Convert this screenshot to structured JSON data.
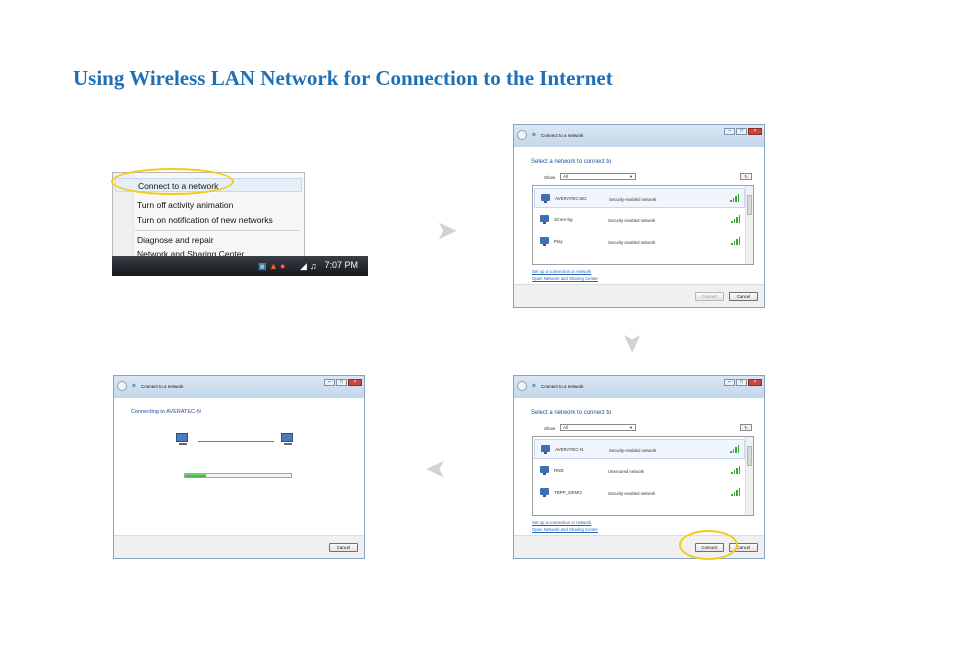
{
  "page": {
    "title": "Using Wireless LAN Network for Connection to the Internet"
  },
  "step1": {
    "menu_items": [
      "Connect to a network",
      "Turn off activity animation",
      "Turn on notification of new networks",
      "Diagnose and repair",
      "Network and Sharing Center"
    ],
    "tray_time": "7:07 PM"
  },
  "step2": {
    "window_title": "Connect to a network",
    "heading": "Select a network to connect to",
    "show_label": "Show",
    "show_value": "All",
    "networks": [
      {
        "name": "AVERATEC-BG",
        "security": "Security-enabled network"
      },
      {
        "name": "3Com-bg",
        "security": "Security-enabled network"
      },
      {
        "name": "Play",
        "security": "Security-enabled network"
      }
    ],
    "link_setup": "Set up a connection or network",
    "link_center": "Open Network and Sharing Center",
    "connect_label": "Connect",
    "cancel_label": "Cancel"
  },
  "step3": {
    "window_title": "Connect to a network",
    "heading": "Select a network to connect to",
    "show_label": "Show",
    "show_value": "All",
    "networks": [
      {
        "name": "AVERATEC-N",
        "security": "Security-enabled network"
      },
      {
        "name": "RND",
        "security": "Unsecured network"
      },
      {
        "name": "TBPP_DEMO",
        "security": "Security-enabled network"
      }
    ],
    "link_setup": "Set up a connection or network",
    "link_center": "Open Network and Sharing Center",
    "connect_label": "Connect",
    "cancel_label": "Cancel"
  },
  "step4": {
    "window_title": "Connect to a network",
    "heading": "Connecting to AVERATEC-N",
    "progress": 0.2,
    "cancel_label": "Cancel"
  },
  "colors": {
    "title": "#1f6fb5",
    "highlight_ring": "#f0cc1c",
    "progress_fill": "#39a836",
    "arrow": "#cfd2d6"
  }
}
